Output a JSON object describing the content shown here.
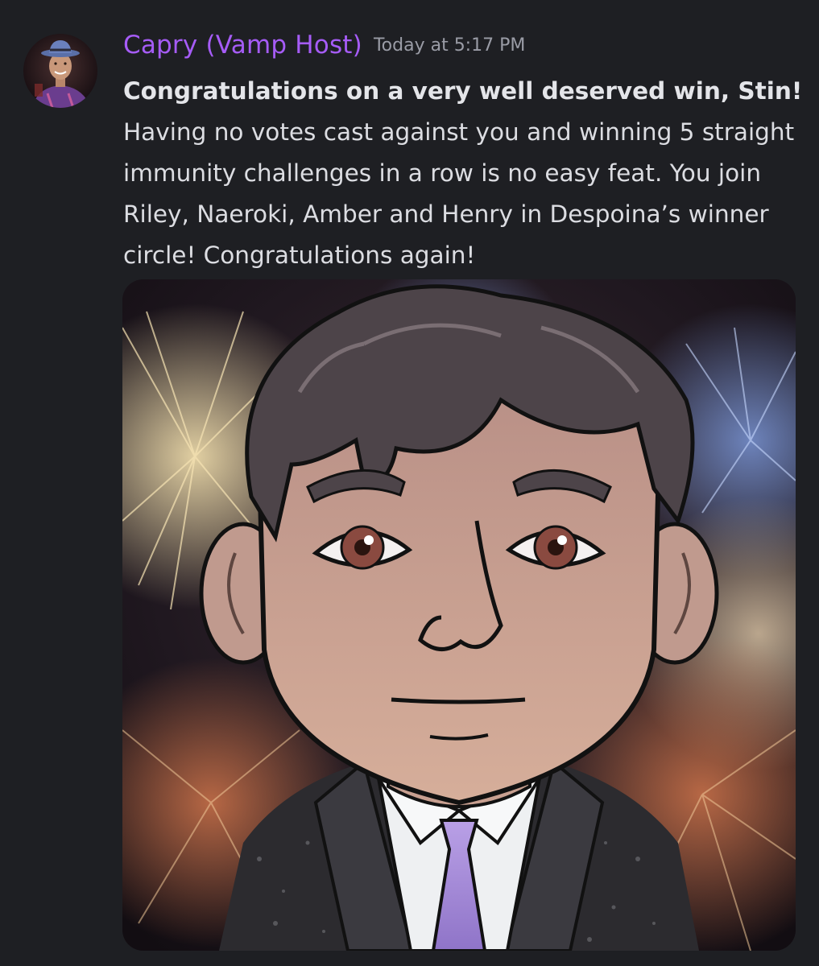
{
  "message": {
    "author": {
      "name": "Capry (Vamp Host)",
      "name_color": "#a65cf7",
      "avatar_icon": "user-avatar-photo"
    },
    "timestamp": "Today at 5:17 PM",
    "content": {
      "bold_text": "Congratulations on a very well deserved win, Stin!",
      "text": " Having no votes cast against you and winning 5 straight immunity challenges in a row is no easy feat. You join Riley, Naeroki, Amber and Henry in Despoina’s winner circle! Congratulations again!"
    },
    "attachment": {
      "type": "image",
      "description_icon": "cartoon-avatar-fireworks-image"
    }
  }
}
